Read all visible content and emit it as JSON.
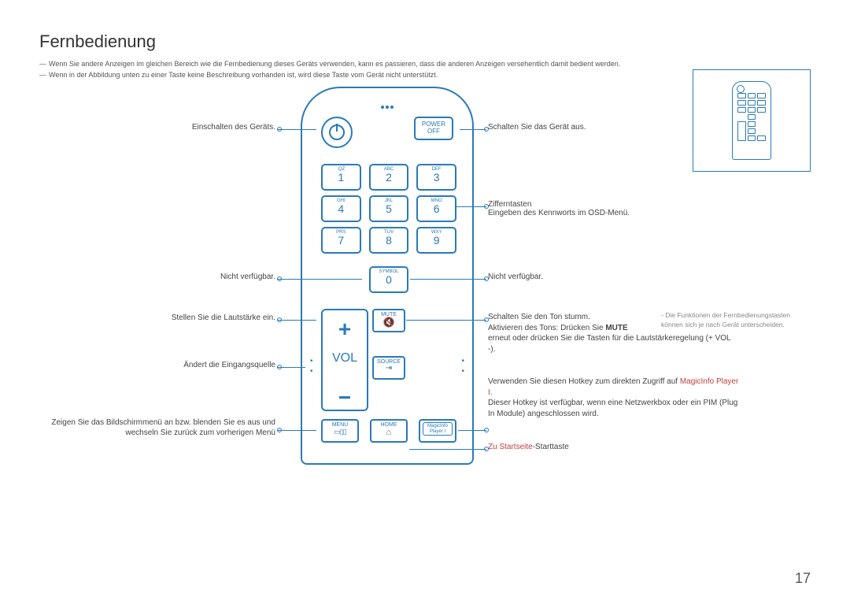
{
  "title": "Fernbedienung",
  "notes": {
    "n1": "Wenn Sie andere Anzeigen im gleichen Bereich wie die Fernbedienung dieses Geräts verwenden, kann es passieren, dass die anderen Anzeigen versehentlich damit bedient werden.",
    "n2": "Wenn in der Abbildung unten zu einer Taste keine Beschreibung vorhanden ist, wird diese Taste vom Gerät nicht unterstützt."
  },
  "buttons": {
    "poweroff_l1": "POWER",
    "poweroff_l2": "OFF",
    "vol": "VOL",
    "mute": "MUTE",
    "source": "SOURCE",
    "menu": "MENU",
    "home": "HOME",
    "magic_l1": "MagicInfo",
    "magic_l2": "Player I"
  },
  "numpad": {
    "k1s": ".QZ",
    "k1": "1",
    "k2s": "ABC",
    "k2": "2",
    "k3s": "DEF",
    "k3": "3",
    "k4s": "GHI",
    "k4": "4",
    "k5s": "JKL",
    "k5": "5",
    "k6s": "MNO",
    "k6": "6",
    "k7s": "PRS",
    "k7": "7",
    "k8s": "TUV",
    "k8": "8",
    "k9s": "WXY",
    "k9": "9",
    "k0s": "SYMBOL",
    "k0": "0"
  },
  "labels": {
    "left": {
      "power": "Einschalten des Geräts.",
      "na": "Nicht verfügbar.",
      "vol": "Stellen Sie die Lautstärke ein.",
      "source": "Ändert die Eingangsquelle",
      "menu": "Zeigen Sie das Bildschirmmenü an bzw. blenden Sie es aus und wechseln Sie zurück zum vorherigen Menü"
    },
    "right": {
      "poweroff": "Schalten Sie das Gerät aus.",
      "num_l1": "Zifferntasten",
      "num_l2": "Eingeben des Kennworts im OSD-Menü.",
      "na": "Nicht verfügbar.",
      "mute_l1": "Schalten Sie den Ton stumm.",
      "mute_l2a": "Aktivieren des Tons: Drücken Sie ",
      "mute_l2b": "MUTE",
      "mute_l3": "erneut oder drücken Sie die Tasten für die Lautstärkeregelung (+ VOL -).",
      "magic_l1a": "Verwenden Sie diesen Hotkey zum direkten Zugriff auf ",
      "magic_l1b": "MagicInfo Player I",
      "magic_l1c": ".",
      "magic_l2": "Dieser Hotkey ist verfügbar, wenn eine Netzwerkbox oder ein PIM (Plug In Module) angeschlossen wird.",
      "home_a": "Zu Startseite",
      "home_b": "-Starttaste"
    }
  },
  "sidenote": "Die Funktionen der Fernbedienungstasten können sich je nach Gerät unterscheiden.",
  "pagenum": "17"
}
